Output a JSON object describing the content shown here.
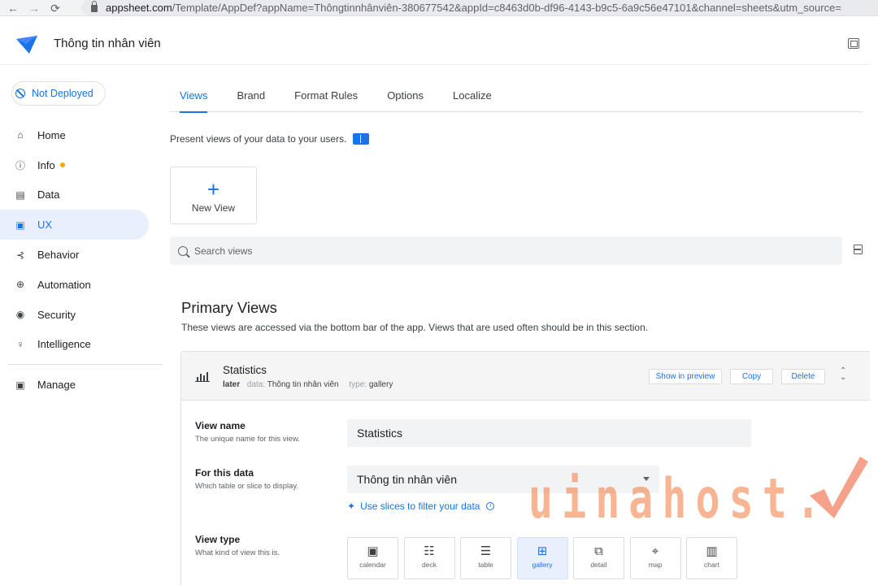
{
  "browser": {
    "back_glyph": "←",
    "forward_glyph": "→",
    "reload_glyph": "⟳",
    "url_host": "appsheet.com",
    "url_path": "/Template/AppDef?appName=Thôngtinnhânviên-380677542&appId=c8463d0b-df96-4143-b9c5-6a9c56e47101&channel=sheets&utm_source="
  },
  "header": {
    "app_title": "Thông tin nhân viên",
    "logo_color": "#1a73e8"
  },
  "sidebar": {
    "deploy_status": "Not Deployed",
    "items": [
      {
        "label": "Home",
        "icon": "home-icon",
        "glyph": "⌂"
      },
      {
        "label": "Info",
        "icon": "info-icon",
        "glyph": "ⓘ"
      },
      {
        "label": "Data",
        "icon": "data-icon",
        "glyph": "▤"
      },
      {
        "label": "UX",
        "icon": "ux-icon",
        "glyph": "▣"
      },
      {
        "label": "Behavior",
        "icon": "behavior-icon",
        "glyph": "⊰"
      },
      {
        "label": "Automation",
        "icon": "automation-icon",
        "glyph": "⊕"
      },
      {
        "label": "Security",
        "icon": "security-icon",
        "glyph": "◉"
      },
      {
        "label": "Intelligence",
        "icon": "lightbulb-icon",
        "glyph": "♀"
      }
    ],
    "manage": {
      "label": "Manage",
      "icon": "manage-icon",
      "glyph": "▣"
    }
  },
  "tabs": [
    "Views",
    "Brand",
    "Format Rules",
    "Options",
    "Localize"
  ],
  "intro_text": "Present views of your data to your users.",
  "new_view": {
    "label": "New View",
    "glyph": "+"
  },
  "search": {
    "placeholder": "Search views"
  },
  "primary_views": {
    "title": "Primary Views",
    "description": "These views are accessed via the bottom bar of the app. Views that are used often should be in this section."
  },
  "view_card": {
    "name": "Statistics",
    "position": "later",
    "data_label": "data:",
    "data_value": "Thông tin nhân viên",
    "type_label": "type:",
    "type_value": "gallery",
    "show_in_preview": "Show in preview",
    "copy": "Copy",
    "delete": "Delete",
    "updown_glyph_up": "⌃",
    "updown_glyph_down": "⌄"
  },
  "form": {
    "view_name": {
      "label": "View name",
      "help": "The unique name for this view.",
      "value": "Statistics"
    },
    "for_this_data": {
      "label": "For this data",
      "help": "Which table or slice to display.",
      "value": "Thông tin nhân viên"
    },
    "slices_link": "Use slices to filter your data",
    "slices_glyph": "✦",
    "view_type": {
      "label": "View type",
      "help": "What kind of view this is.",
      "options": [
        {
          "label": "calendar",
          "glyph": "📅"
        },
        {
          "label": "deck",
          "glyph": "☷"
        },
        {
          "label": "table",
          "glyph": "☰"
        },
        {
          "label": "gallery",
          "glyph": "⊞"
        },
        {
          "label": "detail",
          "glyph": "⧉"
        },
        {
          "label": "map",
          "glyph": "⌖"
        },
        {
          "label": "chart",
          "glyph": "▥"
        }
      ],
      "selected": "gallery"
    }
  },
  "watermark": {
    "text": "uinahost."
  },
  "colors": {
    "accent": "#1a73e8",
    "info_dot": "#f9ab00",
    "watermark": "#f0783c"
  }
}
